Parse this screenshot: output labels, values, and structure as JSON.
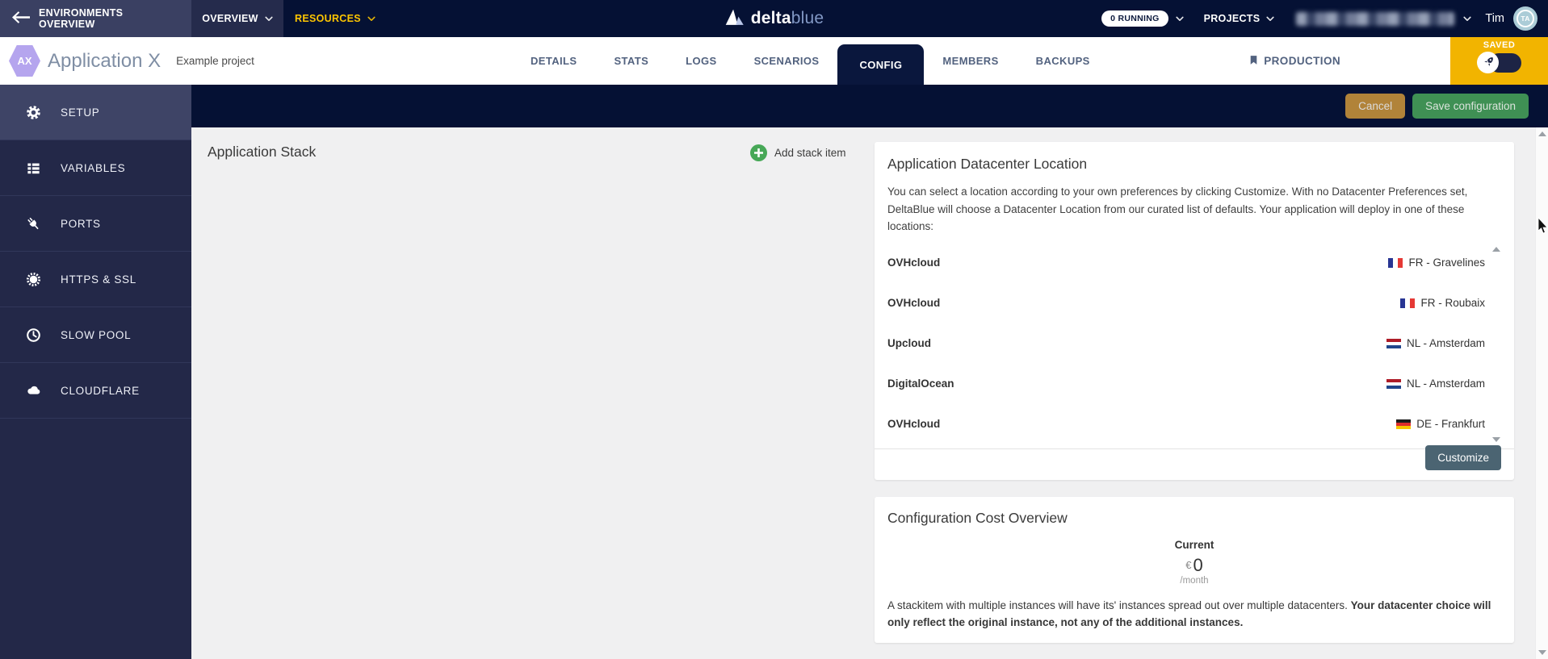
{
  "top_nav": {
    "environments_overview": "ENVIRONMENTS OVERVIEW",
    "overview": "OVERVIEW",
    "resources": "RESOURCES",
    "brand": {
      "delta": "delta",
      "blue": "blue"
    },
    "running_badge": "0 RUNNING",
    "projects": "PROJECTS",
    "user": {
      "name": "Tim",
      "initials": "TA"
    }
  },
  "app_header": {
    "app_initials": "AX",
    "app_name": "Application X",
    "project_name": "Example project",
    "tabs": [
      {
        "label": "DETAILS",
        "active": false
      },
      {
        "label": "STATS",
        "active": false
      },
      {
        "label": "LOGS",
        "active": false
      },
      {
        "label": "SCENARIOS",
        "active": false
      },
      {
        "label": "CONFIG",
        "active": true
      },
      {
        "label": "MEMBERS",
        "active": false
      },
      {
        "label": "BACKUPS",
        "active": false
      }
    ],
    "production_badge": "PRODUCTION",
    "saved_label": "SAVED"
  },
  "toolbar": {
    "cancel_label": "Cancel",
    "save_label": "Save configuration"
  },
  "sidebar": {
    "items": [
      {
        "label": "SETUP",
        "icon": "gear",
        "active": true
      },
      {
        "label": "VARIABLES",
        "icon": "list",
        "active": false
      },
      {
        "label": "PORTS",
        "icon": "plug",
        "active": false
      },
      {
        "label": "HTTPS & SSL",
        "icon": "certificate",
        "active": false
      },
      {
        "label": "SLOW POOL",
        "icon": "clock",
        "active": false
      },
      {
        "label": "CLOUDFLARE",
        "icon": "cloud",
        "active": false
      }
    ]
  },
  "main": {
    "stack_title": "Application Stack",
    "add_stack_item": "Add stack item",
    "datacenter_card": {
      "title": "Application Datacenter Location",
      "description": "You can select a location according to your own preferences by clicking Customize. With no Datacenter Preferences set, DeltaBlue will choose a Datacenter Location from our curated list of defaults. Your application will deploy in one of these locations:",
      "locations": [
        {
          "provider": "OVHcloud",
          "location": "FR - Gravelines",
          "flag": "FR"
        },
        {
          "provider": "OVHcloud",
          "location": "FR - Roubaix",
          "flag": "FR"
        },
        {
          "provider": "Upcloud",
          "location": "NL - Amsterdam",
          "flag": "NL"
        },
        {
          "provider": "DigitalOcean",
          "location": "NL - Amsterdam",
          "flag": "NL"
        },
        {
          "provider": "OVHcloud",
          "location": "DE - Frankfurt",
          "flag": "DE"
        }
      ],
      "customize_button": "Customize"
    },
    "cost_card": {
      "title": "Configuration Cost Overview",
      "current_label": "Current",
      "currency": "€",
      "amount": "0",
      "period": "/month",
      "note_normal": "A stackitem with multiple instances will have its' instances spread out over multiple datacenters. ",
      "note_bold": "Your datacenter choice will only reflect the original instance, not any of the additional instances."
    }
  },
  "colors": {
    "brand_navy": "#051134",
    "nav_section_light": "#3a4062",
    "nav_section_mid": "#252b4c",
    "accent_yellow": "#f2b400",
    "resources_yellow": "#fdc500",
    "save_green": "#3f9054",
    "cancel_bronze": "#b18339",
    "customize_slate": "#4b6472",
    "add_green": "#47a857",
    "hexagon_purple": "#b5a5ee",
    "avatar_teal": "#abccd7",
    "sidebar_navy": "#232848",
    "sidebar_active": "#3e4466",
    "content_gray": "#f0f0f1"
  }
}
